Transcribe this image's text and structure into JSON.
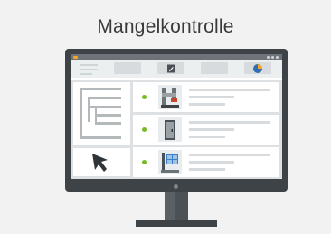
{
  "title": "Mangelkontrolle",
  "colors": {
    "background": "#f2f2f2",
    "accent": "#7ab929",
    "monitor": "#3d4347"
  },
  "toolbar": {
    "icons": [
      "menu-lines-icon",
      "edit-document-icon",
      "pie-chart-icon"
    ]
  },
  "rows": [
    {
      "thumbnail": "pipe-installation-icon"
    },
    {
      "thumbnail": "door-icon"
    },
    {
      "thumbnail": "tiled-window-icon"
    }
  ]
}
